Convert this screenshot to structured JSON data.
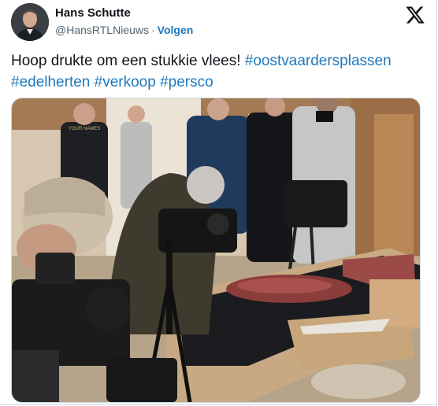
{
  "author": {
    "name": "Hans Schutte",
    "handle": "@HansRTLNieuws",
    "separator": "·",
    "follow_label": "Volgen"
  },
  "tweet": {
    "text": "Hoop drukte om een stukkie vlees!",
    "hashtags": [
      "#oostvaardersplassen",
      "#edelherten",
      "#verkoop",
      "#persco"
    ]
  },
  "media": {
    "sign_text": "YOUR NAMES"
  },
  "colors": {
    "link": "#1d78bf",
    "text": "#0f1419",
    "secondary": "#536471",
    "border": "#cfd9de"
  },
  "icons": {
    "platform": "x-logo-icon"
  }
}
